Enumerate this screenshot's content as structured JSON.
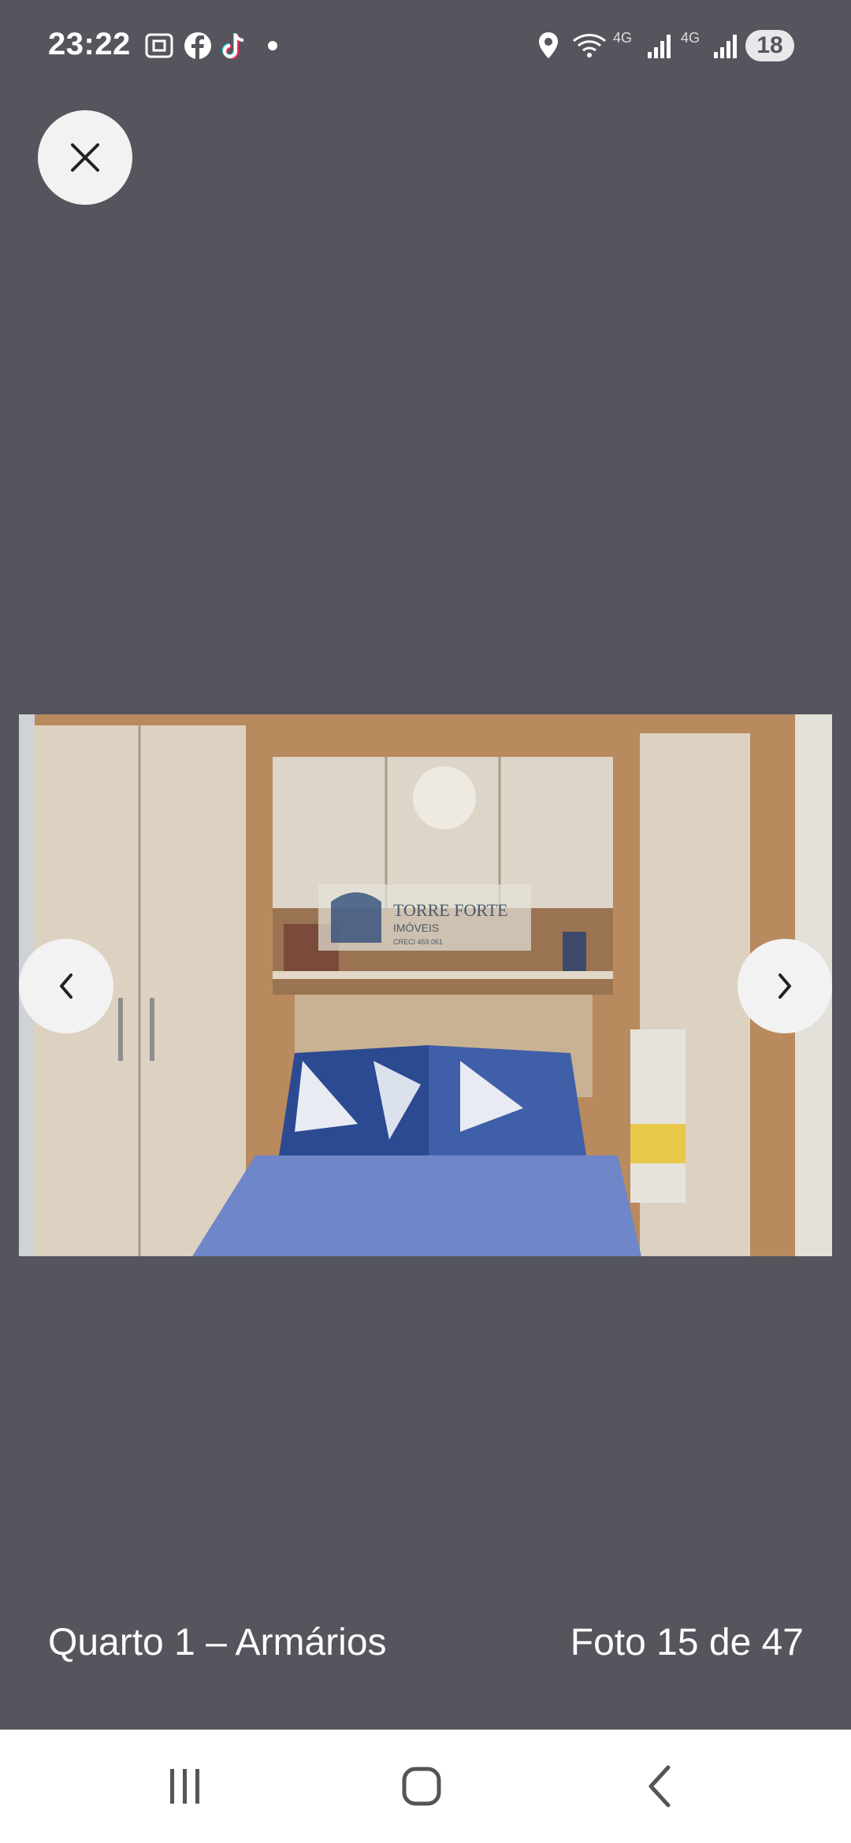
{
  "status_bar": {
    "time": "23:22",
    "network_label_1": "4G",
    "network_label_2": "4G",
    "battery": "18"
  },
  "viewer": {
    "caption": "Quarto 1 – Armários",
    "counter": "Foto 15 de 47",
    "watermark": {
      "name": "TORRE FORTE",
      "sub": "IMÓVEIS",
      "creci": "CRECI 459.061"
    }
  },
  "icons": {
    "close": "close-icon",
    "prev": "chevron-left-icon",
    "next": "chevron-right-icon",
    "recents": "recents-icon",
    "home": "home-icon",
    "back": "back-icon"
  },
  "colors": {
    "background": "#55555e",
    "nav_bar": "#ffffff",
    "button": "#f2f2f2"
  }
}
